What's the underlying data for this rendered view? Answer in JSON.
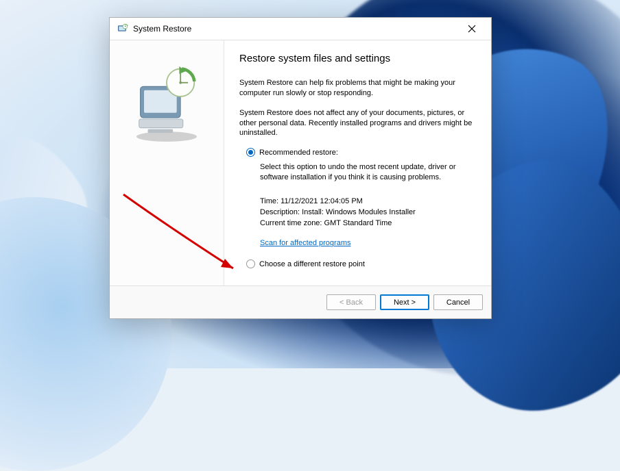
{
  "titlebar": {
    "title": "System Restore"
  },
  "content": {
    "heading": "Restore system files and settings",
    "intro1": "System Restore can help fix problems that might be making your computer run slowly or stop responding.",
    "intro2": "System Restore does not affect any of your documents, pictures, or other personal data. Recently installed programs and drivers might be uninstalled."
  },
  "options": {
    "recommended_label": "Recommended restore:",
    "recommended_desc": "Select this option to undo the most recent update, driver or software installation if you think it is causing problems.",
    "time_label": "Time:",
    "time_value": "11/12/2021 12:04:05 PM",
    "description_label": "Description:",
    "description_value": "Install: Windows Modules Installer",
    "timezone_label": "Current time zone:",
    "timezone_value": "GMT Standard Time",
    "scan_link": "Scan for affected programs",
    "different_label": "Choose a different restore point"
  },
  "buttons": {
    "back": "< Back",
    "next": "Next >",
    "cancel": "Cancel"
  }
}
